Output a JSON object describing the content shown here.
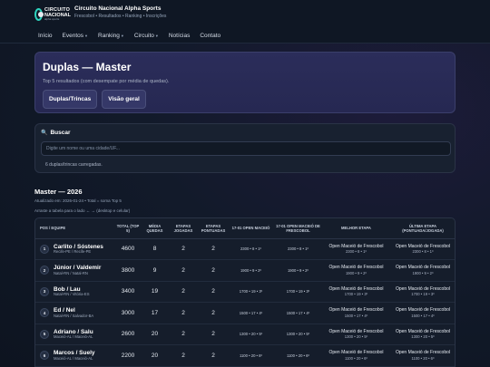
{
  "brand": {
    "logo_line1": "CIRCUITO",
    "logo_line2": "NACIONAL",
    "logo_line3": "alpha sports",
    "title": "Circuito Nacional Alpha Sports",
    "subtitle": "Frescobol • Resultados • Ranking • Inscrições"
  },
  "nav": [
    {
      "label": "Início",
      "dropdown": false
    },
    {
      "label": "Eventos",
      "dropdown": true
    },
    {
      "label": "Ranking",
      "dropdown": true
    },
    {
      "label": "Circuito",
      "dropdown": true
    },
    {
      "label": "Notícias",
      "dropdown": false
    },
    {
      "label": "Contato",
      "dropdown": false
    }
  ],
  "hero": {
    "title": "Duplas — Master",
    "description": "Top 5 resultados (com desempate por média de quedas).",
    "button1": "Duplas/Trincas",
    "button2": "Visão geral"
  },
  "search": {
    "title": "Buscar",
    "icon": "magnifier-icon",
    "placeholder": "Digite um nome ou uma cidade/UF...",
    "count": "6 duplas/trincas carregadas."
  },
  "section": {
    "title": "Master — 2026",
    "meta": "Atualizado em: 2026-01-24 • Total = soma Top 5",
    "hint": "Arraste a tabela para o lado ← → (desktop e celular)"
  },
  "table": {
    "headers": {
      "pos": "POS / EQUIPE",
      "total": "TOTAL (TOP 5)",
      "media": "MÉDIA QUEDAS",
      "jogadas": "ETAPAS JOGADAS",
      "pontuadas": "ETAPAS PONTUADAS",
      "open17": "17-01 OPEN MACEIÓ",
      "open_frescobol": "17-01 OPEN MACEIÓ DE FRESCOBOL",
      "melhor": "MELHOR ETAPA",
      "ultima": "ÚLTIMA ETAPA (PONTUADA/JOGADA)"
    },
    "rows": [
      {
        "pos": "1",
        "name": "Carlito / Sóstenes",
        "city": "Recife-PE / Recife-PE",
        "total": "4600",
        "media": "8",
        "jogadas": "2",
        "pontuadas": "2",
        "open17": "2300 • 8 • 1º",
        "open_frescobol": "2300 • 8 • 1º",
        "melhor_nome": "Open Maceió de Frescobol",
        "melhor_info": "2300 • 8 • 1º",
        "ultima_nome": "Open Maceió de Frescobol",
        "ultima_info": "2300 • 8 • 1º"
      },
      {
        "pos": "2",
        "name": "Júnior / Valdemir",
        "city": "Natal-RN / Natal-RN",
        "total": "3800",
        "media": "9",
        "jogadas": "2",
        "pontuadas": "2",
        "open17": "1900 • 9 • 2º",
        "open_frescobol": "1900 • 9 • 2º",
        "melhor_nome": "Open Maceió de Frescobol",
        "melhor_info": "1900 • 9 • 2º",
        "ultima_nome": "Open Maceió de Frescobol",
        "ultima_info": "1900 • 9 • 2º"
      },
      {
        "pos": "3",
        "name": "Bob / Lau",
        "city": "Natal-RN / Vitória-ES",
        "total": "3400",
        "media": "19",
        "jogadas": "2",
        "pontuadas": "2",
        "open17": "1700 • 19 • 3º",
        "open_frescobol": "1700 • 19 • 3º",
        "melhor_nome": "Open Maceió de Frescobol",
        "melhor_info": "1700 • 19 • 3º",
        "ultima_nome": "Open Maceió de Frescobol",
        "ultima_info": "1700 • 19 • 3º"
      },
      {
        "pos": "4",
        "name": "Ed / Nel",
        "city": "Natal-RN / Salvador-BA",
        "total": "3000",
        "media": "17",
        "jogadas": "2",
        "pontuadas": "2",
        "open17": "1500 • 17 • 4º",
        "open_frescobol": "1500 • 17 • 4º",
        "melhor_nome": "Open Maceió de Frescobol",
        "melhor_info": "1500 • 17 • 4º",
        "ultima_nome": "Open Maceió de Frescobol",
        "ultima_info": "1500 • 17 • 4º"
      },
      {
        "pos": "5",
        "name": "Adriano / Salu",
        "city": "Maceió-AL / Maceió-AL",
        "total": "2600",
        "media": "20",
        "jogadas": "2",
        "pontuadas": "2",
        "open17": "1300 • 20 • 5º",
        "open_frescobol": "1300 • 20 • 5º",
        "melhor_nome": "Open Maceió de Frescobol",
        "melhor_info": "1300 • 20 • 5º",
        "ultima_nome": "Open Maceió de Frescobol",
        "ultima_info": "1300 • 20 • 5º"
      },
      {
        "pos": "6",
        "name": "Marcos / Suely",
        "city": "Maceió-AL / Maceió-AL",
        "total": "2200",
        "media": "20",
        "jogadas": "2",
        "pontuadas": "2",
        "open17": "1100 • 20 • 6º",
        "open_frescobol": "1100 • 20 • 6º",
        "melhor_nome": "Open Maceió de Frescobol",
        "melhor_info": "1100 • 20 • 6º",
        "ultima_nome": "Open Maceió de Frescobol",
        "ultima_info": "1100 • 20 • 6º"
      }
    ]
  }
}
